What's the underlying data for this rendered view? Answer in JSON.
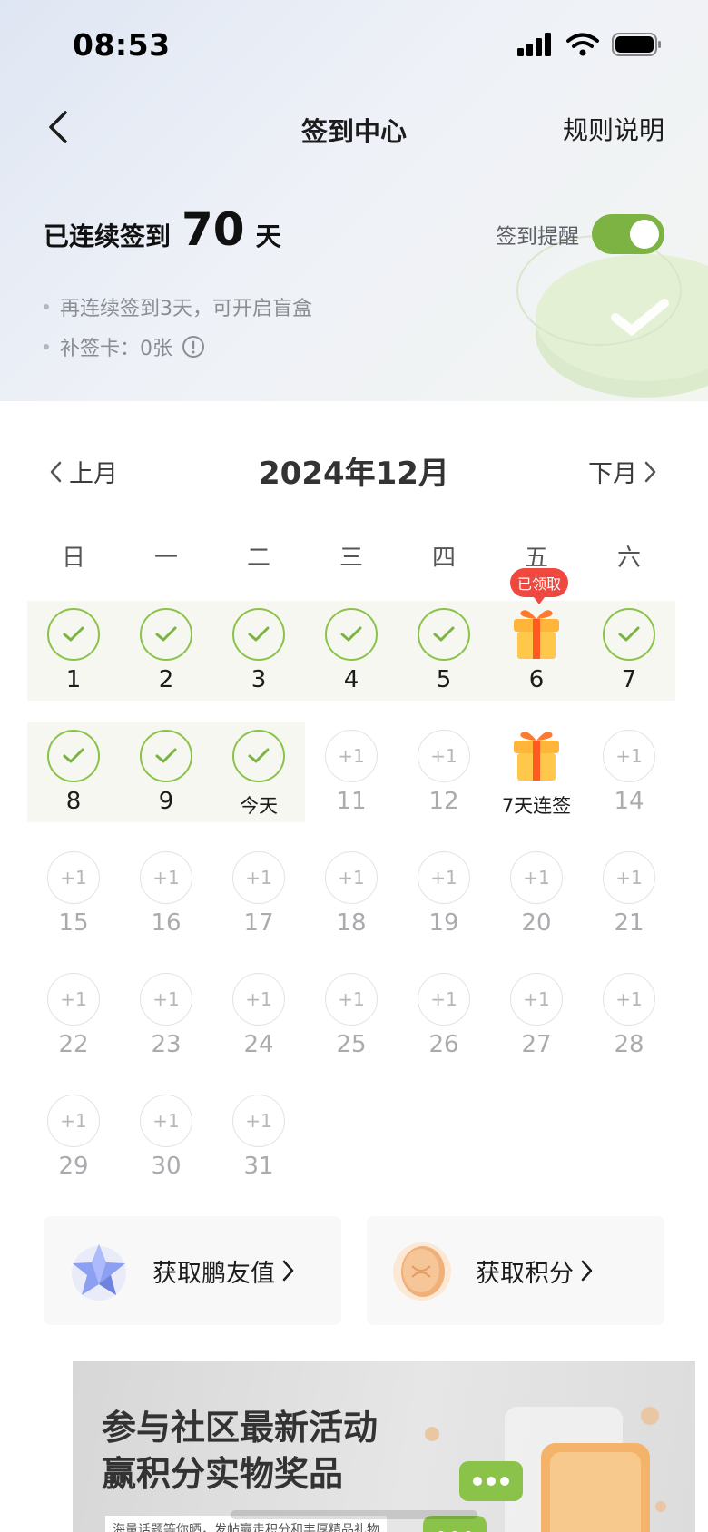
{
  "status_bar": {
    "time": "08:53"
  },
  "nav": {
    "title": "签到中心",
    "rules_label": "规则说明"
  },
  "streak": {
    "prefix": "已连续签到",
    "days": "70",
    "suffix": "天"
  },
  "tips": [
    "再连续签到3天，可开启盲盒",
    "补签卡：0张"
  ],
  "reminder": {
    "label": "签到提醒",
    "enabled": true
  },
  "calendar": {
    "month_title": "2024年12月",
    "prev_label": "上月",
    "next_label": "下月",
    "weekdays": [
      "日",
      "一",
      "二",
      "三",
      "四",
      "五",
      "六"
    ],
    "claimed_badge": "已领取",
    "plus_label": "+1",
    "days": [
      {
        "label": "1",
        "state": "done"
      },
      {
        "label": "2",
        "state": "done"
      },
      {
        "label": "3",
        "state": "done"
      },
      {
        "label": "4",
        "state": "done"
      },
      {
        "label": "5",
        "state": "done"
      },
      {
        "label": "6",
        "state": "gift-claimed"
      },
      {
        "label": "7",
        "state": "done"
      },
      {
        "label": "8",
        "state": "done"
      },
      {
        "label": "9",
        "state": "done"
      },
      {
        "label": "今天",
        "state": "done"
      },
      {
        "label": "11",
        "state": "future"
      },
      {
        "label": "12",
        "state": "future"
      },
      {
        "label": "7天连签",
        "state": "gift"
      },
      {
        "label": "14",
        "state": "future"
      },
      {
        "label": "15",
        "state": "future"
      },
      {
        "label": "16",
        "state": "future"
      },
      {
        "label": "17",
        "state": "future"
      },
      {
        "label": "18",
        "state": "future"
      },
      {
        "label": "19",
        "state": "future"
      },
      {
        "label": "20",
        "state": "future"
      },
      {
        "label": "21",
        "state": "future"
      },
      {
        "label": "22",
        "state": "future"
      },
      {
        "label": "23",
        "state": "future"
      },
      {
        "label": "24",
        "state": "future"
      },
      {
        "label": "25",
        "state": "future"
      },
      {
        "label": "26",
        "state": "future"
      },
      {
        "label": "27",
        "state": "future"
      },
      {
        "label": "28",
        "state": "future"
      },
      {
        "label": "29",
        "state": "future"
      },
      {
        "label": "30",
        "state": "future"
      },
      {
        "label": "31",
        "state": "future"
      }
    ]
  },
  "rewards": [
    {
      "label": "获取鹏友值",
      "icon": "star-crystal-icon"
    },
    {
      "label": "获取积分",
      "icon": "coin-icon"
    }
  ],
  "banner": {
    "title_line1": "参与社区最新活动",
    "title_line2": "赢积分实物奖品",
    "subtitle": "海量话题等你晒，发帖赢走积分和丰厚精品礼物"
  },
  "colors": {
    "accent": "#7cb342",
    "badge": "#f0483e"
  }
}
